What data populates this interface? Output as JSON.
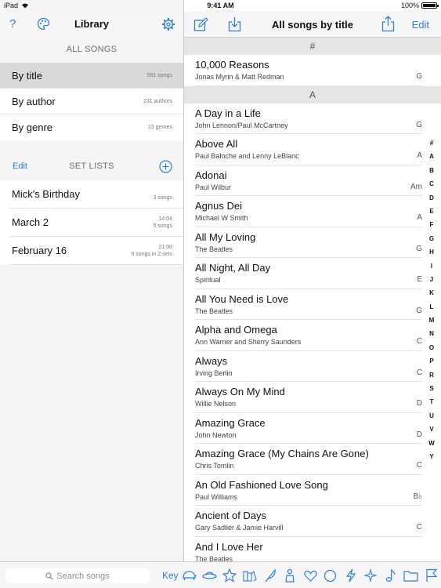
{
  "status": {
    "device": "iPad",
    "time": "9:41 AM",
    "battery": "100%",
    "battery_level": 1.0
  },
  "sidebar": {
    "title": "Library",
    "all_songs_header": "ALL SONGS",
    "items": [
      {
        "label": "By title",
        "count": "591 songs",
        "selected": true
      },
      {
        "label": "By author",
        "count": "231 authors",
        "selected": false
      },
      {
        "label": "By genre",
        "count": "13 genres",
        "selected": false
      }
    ],
    "setlists_edit": "Edit",
    "setlists_header": "SET LISTS",
    "setlists": [
      {
        "name": "Mick's Birthday",
        "meta1": "",
        "meta2": "3 songs"
      },
      {
        "name": "March 2",
        "meta1": "14:04",
        "meta2": "5 songs"
      },
      {
        "name": "February 16",
        "meta1": "21:00",
        "meta2": "6 songs in 2 sets"
      }
    ]
  },
  "main": {
    "title": "All songs by title",
    "edit_label": "Edit",
    "groups": [
      {
        "header": "#",
        "songs": [
          {
            "title": "10,000 Reasons",
            "author": "Jonas Myrin & Matt Redman",
            "key": "G"
          }
        ]
      },
      {
        "header": "A",
        "songs": [
          {
            "title": "A Day in a Life",
            "author": "John Lennon/Paul McCartney",
            "key": "G"
          },
          {
            "title": "Above All",
            "author": "Paul Baloche and Lenny LeBlanc",
            "key": "A"
          },
          {
            "title": "Adonai",
            "author": "Paul Wilbur",
            "key": "Am"
          },
          {
            "title": "Agnus Dei",
            "author": "Michael W Smith",
            "key": "A"
          },
          {
            "title": "All My Loving",
            "author": "The Beatles",
            "key": "G"
          },
          {
            "title": "All Night, All Day",
            "author": "Spiritual",
            "key": "E"
          },
          {
            "title": "All You Need is Love",
            "author": "The Beatles",
            "key": "G"
          },
          {
            "title": "Alpha and Omega",
            "author": "Ann Warner and Sherry Saunders",
            "key": "C"
          },
          {
            "title": "Always",
            "author": "Irving Berlin",
            "key": "C"
          },
          {
            "title": "Always On My Mind",
            "author": "Willie Nelson",
            "key": "D"
          },
          {
            "title": "Amazing Grace",
            "author": "John Newton",
            "key": "D"
          },
          {
            "title": "Amazing Grace (My Chains Are Gone)",
            "author": "Chris Tomlin",
            "key": "C"
          },
          {
            "title": "An Old Fashioned Love Song",
            "author": "Paul Williams",
            "key": "B♭"
          },
          {
            "title": "Ancient of Days",
            "author": "Gary Sadlier & Jamie Harvill",
            "key": "C"
          },
          {
            "title": "And I Love Her",
            "author": "The Beatles",
            "key": ""
          }
        ]
      }
    ],
    "index_letters": [
      "#",
      "A",
      "B",
      "C",
      "D",
      "E",
      "F",
      "G",
      "H",
      "I",
      "J",
      "K",
      "L",
      "M",
      "N",
      "O",
      "P",
      "R",
      "S",
      "T",
      "U",
      "V",
      "W",
      "Y"
    ]
  },
  "toolbar": {
    "search_placeholder": "Search songs",
    "key_label": "Key",
    "genre_icons": [
      "turtle-icon",
      "ufo-icon",
      "star-icon",
      "books-icon",
      "feather-icon",
      "figure-icon",
      "heart-icon",
      "circle-icon",
      "lightning-icon",
      "sparkle-icon",
      "music-note-icon",
      "folder-icon",
      "flag-icon"
    ]
  },
  "colors": {
    "accent": "#2f7ed8",
    "selected_row": "#d9d9d9",
    "section_header": "#e5e5e5"
  }
}
